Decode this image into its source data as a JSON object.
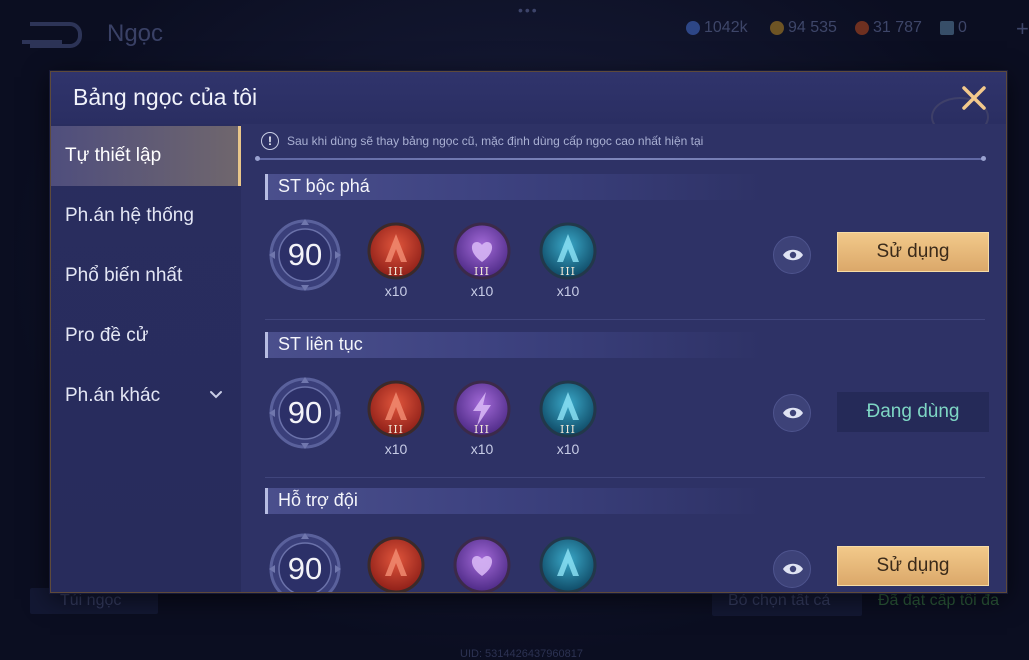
{
  "background": {
    "title": "Ngọc",
    "currencies": [
      {
        "icon": "blue-gem-coin-icon",
        "value": "1042k",
        "color": "#3b5aa8"
      },
      {
        "icon": "gold-coin-icon",
        "value": "94 535",
        "color": "#a07a2e"
      },
      {
        "icon": "red-coin-icon",
        "value": "31 787",
        "color": "#a3442a"
      },
      {
        "icon": "voucher-icon",
        "value": "0",
        "color": "#4b6a8e"
      }
    ],
    "bottom_left_button": "Tủi ngọc",
    "bottom_mid_button": "Bỏ chọn tất cả",
    "bottom_right_text": "Đã đạt cấp tối đa",
    "uid": "UID: 5314426437960817"
  },
  "modal": {
    "title": "Bảng ngọc của tôi",
    "notice": "Sau khi dùng sẽ thay bảng ngọc cũ, mặc định dùng cấp ngọc cao nhất hiện tại",
    "sidebar": [
      {
        "label": "Tự thiết lập",
        "active": true
      },
      {
        "label": "Ph.án hệ thống",
        "active": false
      },
      {
        "label": "Phổ biến nhất",
        "active": false
      },
      {
        "label": "Pro đề cử",
        "active": false
      },
      {
        "label": "Ph.án khác",
        "active": false,
        "expandable": true
      }
    ],
    "sets": [
      {
        "name": "ST bộc phá",
        "level": "90",
        "gems": [
          {
            "color": "red",
            "icon": "red-attack-gem-icon",
            "tier": "III",
            "count": "x10"
          },
          {
            "color": "purple",
            "icon": "purple-heart-gem-icon",
            "tier": "III",
            "count": "x10"
          },
          {
            "color": "teal",
            "icon": "teal-attack-gem-icon",
            "tier": "III",
            "count": "x10"
          }
        ],
        "action": "Sử dụng",
        "in_use": false
      },
      {
        "name": "ST liên tục",
        "level": "90",
        "gems": [
          {
            "color": "red",
            "icon": "red-attack-gem-icon",
            "tier": "III",
            "count": "x10"
          },
          {
            "color": "purple",
            "icon": "purple-lightning-gem-icon",
            "tier": "III",
            "count": "x10"
          },
          {
            "color": "teal",
            "icon": "teal-attack-gem-icon",
            "tier": "III",
            "count": "x10"
          }
        ],
        "action": "Đang dùng",
        "in_use": true
      },
      {
        "name": "Hỗ trợ đội",
        "level": "90",
        "gems": [
          {
            "color": "red",
            "icon": "red-attack-gem-icon",
            "tier": "",
            "count": ""
          },
          {
            "color": "purple",
            "icon": "purple-heart-gem-icon",
            "tier": "",
            "count": ""
          },
          {
            "color": "teal",
            "icon": "teal-attack-gem-icon",
            "tier": "",
            "count": ""
          }
        ],
        "action": "Sử dụng",
        "in_use": false
      }
    ]
  },
  "colors": {
    "accent_gold": "#e8c68a",
    "in_use_text": "#7ed6c4",
    "modal_bg": "#2e3266"
  }
}
